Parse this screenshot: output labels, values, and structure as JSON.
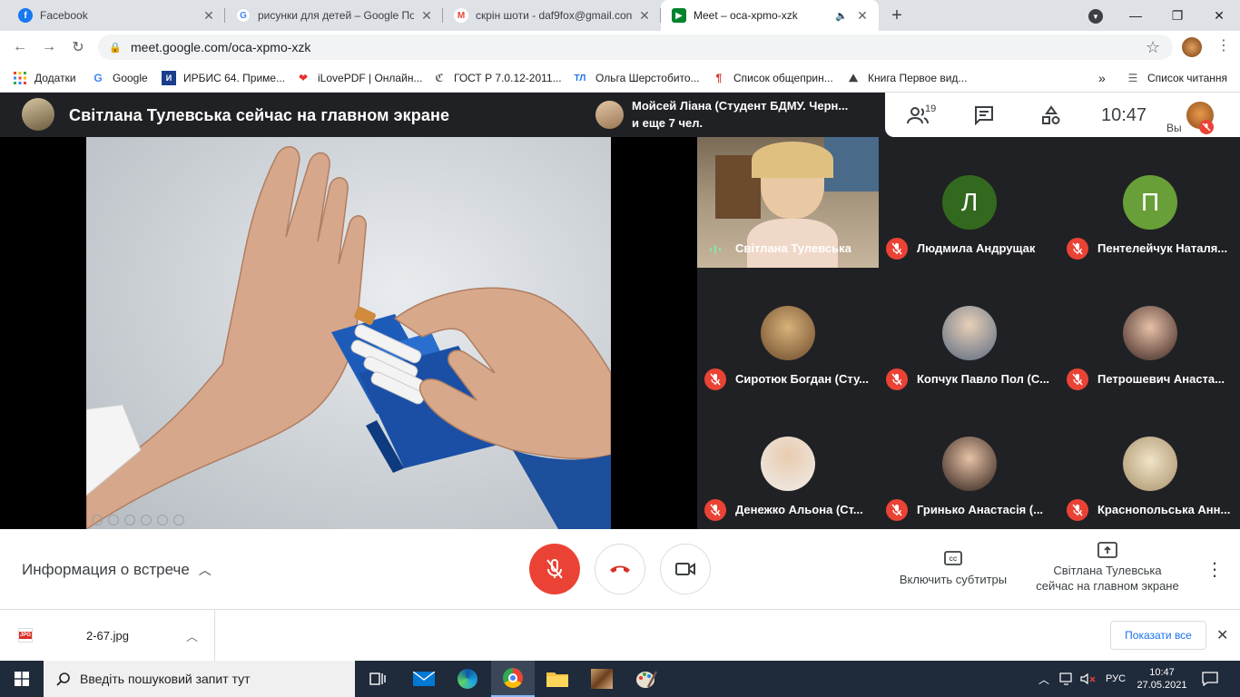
{
  "browser": {
    "tabs": [
      {
        "title": "Facebook",
        "favicon": "facebook-icon",
        "color": "#1877f2"
      },
      {
        "title": "рисунки для детей – Google По",
        "favicon": "google-icon",
        "color": "#4285f4"
      },
      {
        "title": "скрін шоти - daf9fox@gmail.con",
        "favicon": "gmail-icon",
        "color": "#ea4335"
      },
      {
        "title": "Meet – oca-xpmo-xzk",
        "favicon": "meet-icon",
        "color": "#00832d"
      }
    ],
    "new_tab": "+",
    "address": "meet.google.com/oca-xpmo-xzk",
    "bookmarks": [
      {
        "label": "Додатки",
        "icon": "apps-grid-icon"
      },
      {
        "label": "Google",
        "icon": "google-icon"
      },
      {
        "label": "ИРБИС 64. Приме...",
        "icon": "irbis-icon"
      },
      {
        "label": "iLovePDF | Онлайн...",
        "icon": "ilovepdf-icon"
      },
      {
        "label": "ГОСТ Р 7.0.12-2011...",
        "icon": "gost-icon"
      },
      {
        "label": "Ольга Шерстобито...",
        "icon": "tl-icon"
      },
      {
        "label": "Список общеприн...",
        "icon": "paragraph-icon"
      },
      {
        "label": "Книга Первое вид...",
        "icon": "book-climb-icon"
      }
    ],
    "reading_list": "Список читання",
    "more": "»"
  },
  "meet": {
    "presenter_banner": "Світлана Тулевська сейчас на главном экране",
    "speaker_line1": "Мойсей Ліана (Студент БДМУ. Черн...",
    "speaker_line2": "и еще 7 чел.",
    "participants_count": "19",
    "time": "10:47",
    "you_label": "Вы",
    "participants": [
      {
        "name": "Світлана Тулевська",
        "initial": "",
        "color": "",
        "speaking": true
      },
      {
        "name": "Людмила Андрущак",
        "initial": "Л",
        "color": "#33691e"
      },
      {
        "name": "Пентелейчук Наталя...",
        "initial": "П",
        "color": "#689f38"
      },
      {
        "name": "Сиротюк Богдан (Сту...",
        "initial": "",
        "color": "#c9a26d"
      },
      {
        "name": "Копчук Павло Пол (С...",
        "initial": "",
        "color": "#8b98a8"
      },
      {
        "name": "Петрошевич Анаста...",
        "initial": "",
        "color": "#5a3a2e"
      },
      {
        "name": "Денежко Альона (Ст...",
        "initial": "",
        "color": "#e8e4e0"
      },
      {
        "name": "Гринько Анастасія (...",
        "initial": "",
        "color": "#4a3530"
      },
      {
        "name": "Краснопольська Анн...",
        "initial": "",
        "color": "#d8c9a8"
      }
    ],
    "meeting_info": "Информация о встрече",
    "captions": "Включить субтитры",
    "presenting_line1": "Світлана Тулевська",
    "presenting_line2": "сейчас на главном экране"
  },
  "downloads": {
    "file": "2-67.jpg",
    "show_all": "Показати все"
  },
  "taskbar": {
    "search_placeholder": "Введіть пошуковий запит тут",
    "lang": "РУС",
    "time": "10:47",
    "date": "27.05.2021"
  },
  "colors": {
    "meet_dark": "#202124",
    "mute_red": "#ea4335",
    "accent_blue": "#1a73e8"
  }
}
